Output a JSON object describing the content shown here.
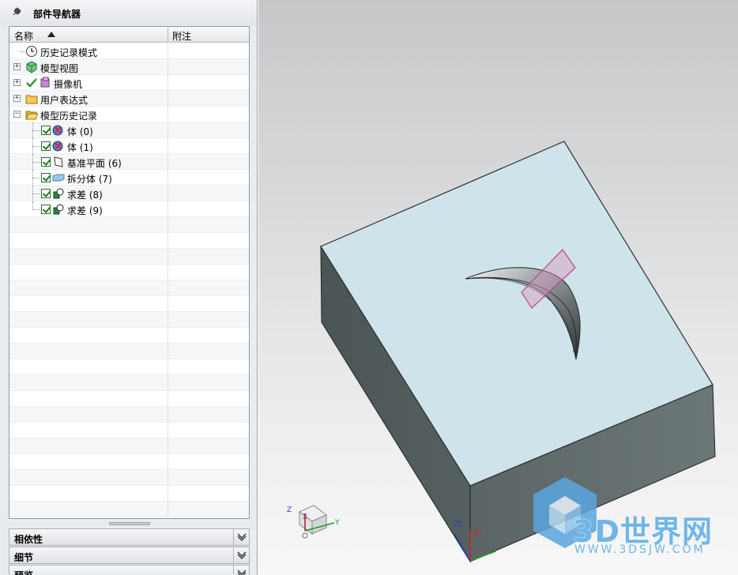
{
  "navigator": {
    "title": "部件导航器",
    "columns": {
      "name": "名称",
      "note": "附注"
    },
    "items": [
      {
        "label": "历史记录模式",
        "icon": "clock-icon"
      },
      {
        "label": "模型视图",
        "icon": "cube-view-icon"
      },
      {
        "label": "摄像机",
        "icon": "camera-icon"
      },
      {
        "label": "用户表达式",
        "icon": "folder-icon"
      },
      {
        "label": "模型历史记录",
        "icon": "folder-open-icon"
      },
      {
        "label": "体 (0)",
        "icon": "body-icon"
      },
      {
        "label": "体 (1)",
        "icon": "body-icon"
      },
      {
        "label": "基准平面 (6)",
        "icon": "datum-plane-icon"
      },
      {
        "label": "拆分体 (7)",
        "icon": "split-body-icon"
      },
      {
        "label": "求差 (8)",
        "icon": "subtract-icon"
      },
      {
        "label": "求差 (9)",
        "icon": "subtract-icon"
      }
    ],
    "panels": [
      {
        "label": "相依性"
      },
      {
        "label": "细节"
      },
      {
        "label": "预览"
      }
    ]
  },
  "viewport": {
    "axes_small": {
      "z": "Z",
      "x": "X",
      "y": "Y"
    },
    "axes_origin": {
      "z": "ZC",
      "x": "XC"
    },
    "watermark": {
      "text": "3D世界网",
      "url": "WWW.3DSJW.COM"
    },
    "colors": {
      "top_face": "#cfe3ea",
      "side_face": "#5f6a6b",
      "accent": "#6fb6e8"
    }
  }
}
